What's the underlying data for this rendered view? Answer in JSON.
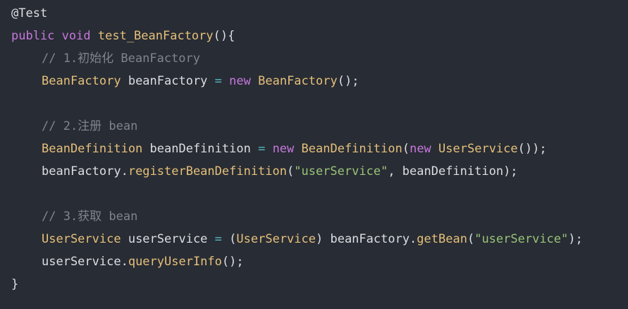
{
  "editor": {
    "background": "#282c34",
    "colors": {
      "default": "#dcdfe4",
      "keyword": "#c678dd",
      "type": "#e5c07b",
      "string": "#98c379",
      "comment": "#7f848e",
      "operator": "#56b6c2"
    },
    "lines": [
      [
        {
          "t": "annotation",
          "v": "@Test"
        }
      ],
      [
        {
          "t": "keyword",
          "v": "public"
        },
        {
          "t": "default",
          "v": " "
        },
        {
          "t": "keyword",
          "v": "void"
        },
        {
          "t": "default",
          "v": " "
        },
        {
          "t": "func",
          "v": "test_BeanFactory"
        },
        {
          "t": "punct",
          "v": "(){"
        }
      ],
      [
        {
          "t": "indent",
          "v": ""
        },
        {
          "t": "comment",
          "v": "// 1.初始化 BeanFactory"
        }
      ],
      [
        {
          "t": "indent",
          "v": ""
        },
        {
          "t": "type",
          "v": "BeanFactory"
        },
        {
          "t": "default",
          "v": " beanFactory "
        },
        {
          "t": "op",
          "v": "="
        },
        {
          "t": "default",
          "v": " "
        },
        {
          "t": "keyword",
          "v": "new"
        },
        {
          "t": "default",
          "v": " "
        },
        {
          "t": "type",
          "v": "BeanFactory"
        },
        {
          "t": "punct",
          "v": "();"
        }
      ],
      [],
      [
        {
          "t": "indent",
          "v": ""
        },
        {
          "t": "comment",
          "v": "// 2.注册 bean"
        }
      ],
      [
        {
          "t": "indent",
          "v": ""
        },
        {
          "t": "type",
          "v": "BeanDefinition"
        },
        {
          "t": "default",
          "v": " beanDefinition "
        },
        {
          "t": "op",
          "v": "="
        },
        {
          "t": "default",
          "v": " "
        },
        {
          "t": "keyword",
          "v": "new"
        },
        {
          "t": "default",
          "v": " "
        },
        {
          "t": "type",
          "v": "BeanDefinition"
        },
        {
          "t": "punct",
          "v": "("
        },
        {
          "t": "keyword",
          "v": "new"
        },
        {
          "t": "default",
          "v": " "
        },
        {
          "t": "type",
          "v": "UserService"
        },
        {
          "t": "punct",
          "v": "());"
        }
      ],
      [
        {
          "t": "indent",
          "v": ""
        },
        {
          "t": "default",
          "v": "beanFactory."
        },
        {
          "t": "method",
          "v": "registerBeanDefinition"
        },
        {
          "t": "punct",
          "v": "("
        },
        {
          "t": "string",
          "v": "\"userService\""
        },
        {
          "t": "punct",
          "v": ", beanDefinition);"
        }
      ],
      [],
      [
        {
          "t": "indent",
          "v": ""
        },
        {
          "t": "comment",
          "v": "// 3.获取 bean"
        }
      ],
      [
        {
          "t": "indent",
          "v": ""
        },
        {
          "t": "type",
          "v": "UserService"
        },
        {
          "t": "default",
          "v": " userService "
        },
        {
          "t": "op",
          "v": "="
        },
        {
          "t": "default",
          "v": " "
        },
        {
          "t": "punct",
          "v": "("
        },
        {
          "t": "type",
          "v": "UserService"
        },
        {
          "t": "punct",
          "v": ") beanFactory."
        },
        {
          "t": "method",
          "v": "getBean"
        },
        {
          "t": "punct",
          "v": "("
        },
        {
          "t": "string",
          "v": "\"userService\""
        },
        {
          "t": "punct",
          "v": ");"
        }
      ],
      [
        {
          "t": "indent",
          "v": ""
        },
        {
          "t": "default",
          "v": "userService."
        },
        {
          "t": "method",
          "v": "queryUserInfo"
        },
        {
          "t": "punct",
          "v": "();"
        }
      ],
      [
        {
          "t": "punct",
          "v": "}"
        }
      ]
    ]
  }
}
